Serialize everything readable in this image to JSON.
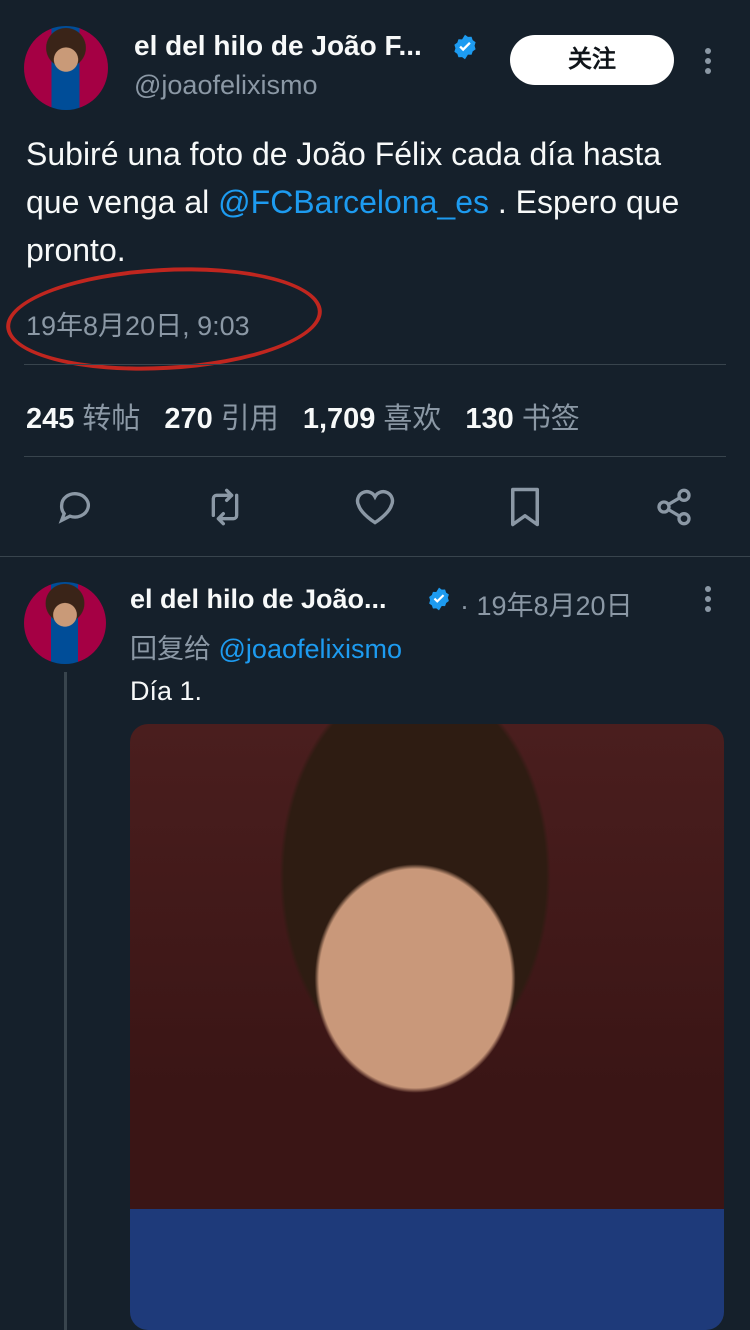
{
  "header": {
    "name": "el del hilo de João F...",
    "handle": "@joaofelixismo",
    "follow_label": "关注"
  },
  "tweet": {
    "text_before": "Subiré una foto de João Félix cada día hasta que venga al ",
    "mention": "@FCBarcelona_es",
    "text_after": " . Espero que pronto.",
    "timestamp": "19年8月20日, 9:03"
  },
  "stats": [
    {
      "count": "245",
      "label": "转帖"
    },
    {
      "count": "270",
      "label": "引用"
    },
    {
      "count": "1,709",
      "label": "喜欢"
    },
    {
      "count": "130",
      "label": "书签"
    }
  ],
  "actions": [
    "reply-icon",
    "retweet-icon",
    "like-icon",
    "bookmark-icon",
    "share-icon"
  ],
  "reply": {
    "name": "el del hilo de João...",
    "meta": "· 19年8月20日",
    "reply_to_prefix": "回复给 ",
    "reply_to_handle": "@joaofelixismo",
    "text": "Día 1."
  },
  "colors": {
    "background": "#15202b",
    "accent": "#1d9bf0",
    "secondary_text": "#8b98a5",
    "highlight_circle": "#c0261f"
  }
}
